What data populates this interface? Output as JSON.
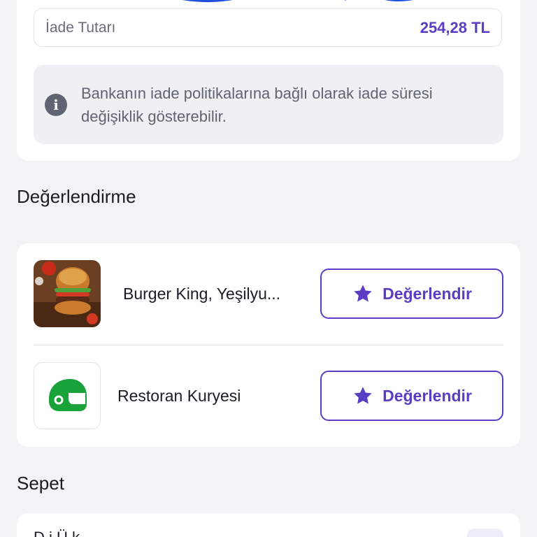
{
  "refund": {
    "label": "İade Tutarı",
    "amount": "254,28 TL",
    "info_icon": "info-icon",
    "info_text": "Bankanın iade politikalarına bağlı olarak iade süresi değişiklik gösterebilir."
  },
  "rating": {
    "title": "Değerlendirme",
    "items": [
      {
        "name": "Burger King, Yeşilyu...",
        "button_label": "Değerlendir",
        "icon": "burger-image"
      },
      {
        "name": "Restoran Kuryesi",
        "button_label": "Değerlendir",
        "icon": "courier-helmet-icon"
      }
    ]
  },
  "basket": {
    "title": "Sepet",
    "first_item_partial": "D    i   Ü  k"
  },
  "colors": {
    "accent": "#5b3cc4",
    "courier_green": "#1aa23a",
    "scribble_blue": "#1f4fe0"
  }
}
